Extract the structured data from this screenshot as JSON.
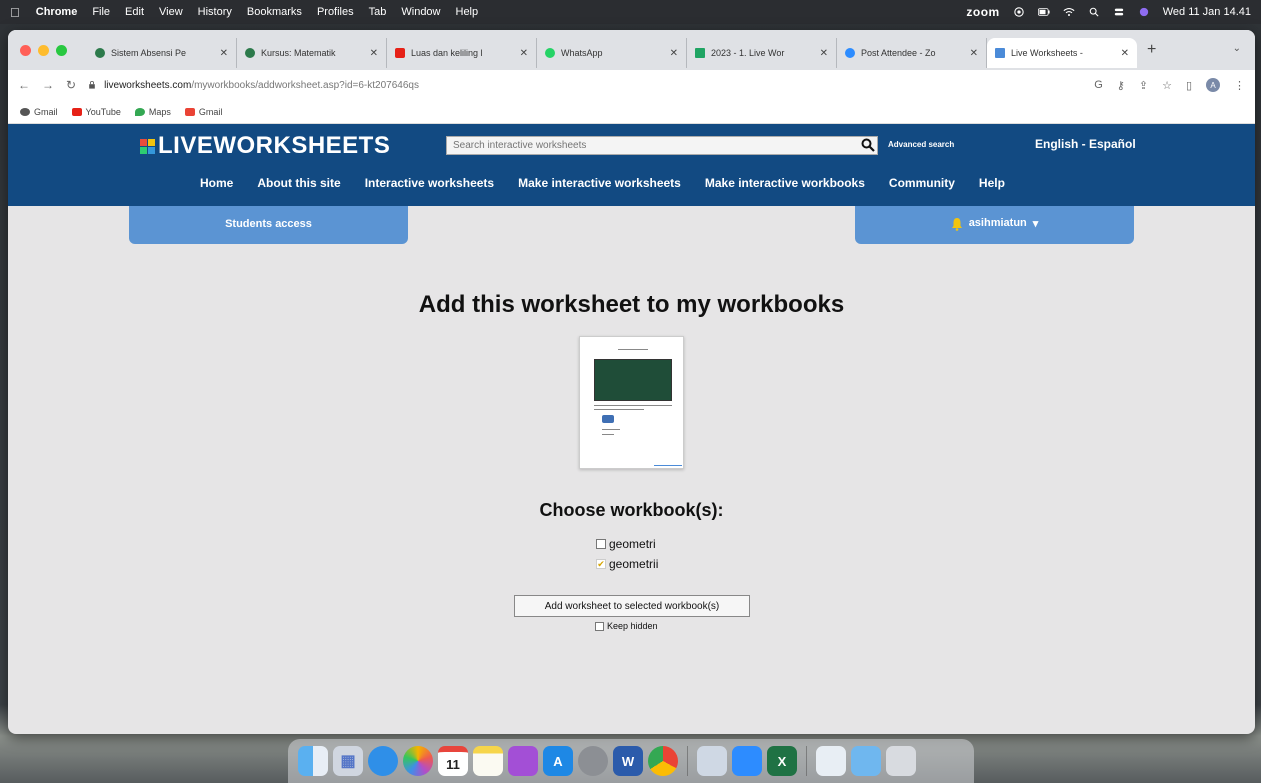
{
  "menubar": {
    "apple_icon": "apple-icon",
    "items": [
      "Chrome",
      "File",
      "Edit",
      "View",
      "History",
      "Bookmarks",
      "Profiles",
      "Tab",
      "Window",
      "Help"
    ],
    "zoom": "zoom",
    "datetime": "Wed 11 Jan 14.41"
  },
  "browser": {
    "tabs": [
      {
        "label": "Sistem Absensi Pe",
        "color": "#2c7a4b"
      },
      {
        "label": "Kursus: Matematik",
        "color": "#2c7a4b"
      },
      {
        "label": "Luas dan keliling l",
        "color": "#e62117"
      },
      {
        "label": "WhatsApp",
        "color": "#25d366"
      },
      {
        "label": "2023 - 1. Live Wor",
        "color": "#1fa463"
      },
      {
        "label": "Post Attendee - Zo",
        "color": "#2d8cff"
      },
      {
        "label": "Live Worksheets -",
        "color": "#4b8bd8"
      }
    ],
    "new_tab": "+",
    "url_host": "liveworksheets.com",
    "url_path": "/myworkbooks/addworksheet.asp?id=6-kt207646qs",
    "profile_initial": "A",
    "bookmarks": [
      {
        "label": "Gmail",
        "color": "#555555"
      },
      {
        "label": "YouTube",
        "color": "#e62117"
      },
      {
        "label": "Maps",
        "color": "#34a853"
      },
      {
        "label": "Gmail",
        "color": "#ea4335"
      }
    ]
  },
  "site": {
    "logo": "LIVEWORKSHEETS",
    "search_placeholder": "Search interactive worksheets",
    "advanced_search": "Advanced search",
    "language": "English - Español",
    "nav": [
      "Home",
      "About this site",
      "Interactive worksheets",
      "Make interactive worksheets",
      "Make interactive workbooks",
      "Community",
      "Help"
    ],
    "students_access": "Students access",
    "username": "asihmiatun",
    "colors": {
      "header": "#124a82",
      "subbar": "#5b94d3"
    }
  },
  "main": {
    "title": "Add this worksheet to my workbooks",
    "choose_label": "Choose workbook(s):",
    "workbooks": [
      {
        "name": "geometri",
        "checked": false
      },
      {
        "name": "geometrii",
        "checked": true
      }
    ],
    "add_button": "Add worksheet to selected workbook(s)",
    "keep_hidden": "Keep hidden"
  },
  "dock": {
    "apps": [
      "finder",
      "launchpad",
      "safari",
      "photos",
      "calendar",
      "notes",
      "podcasts",
      "app-store",
      "system-preferences",
      "word",
      "chrome",
      "preview",
      "zoom",
      "excel",
      "downloads",
      "folder",
      "trash"
    ],
    "calendar_day": "11"
  }
}
